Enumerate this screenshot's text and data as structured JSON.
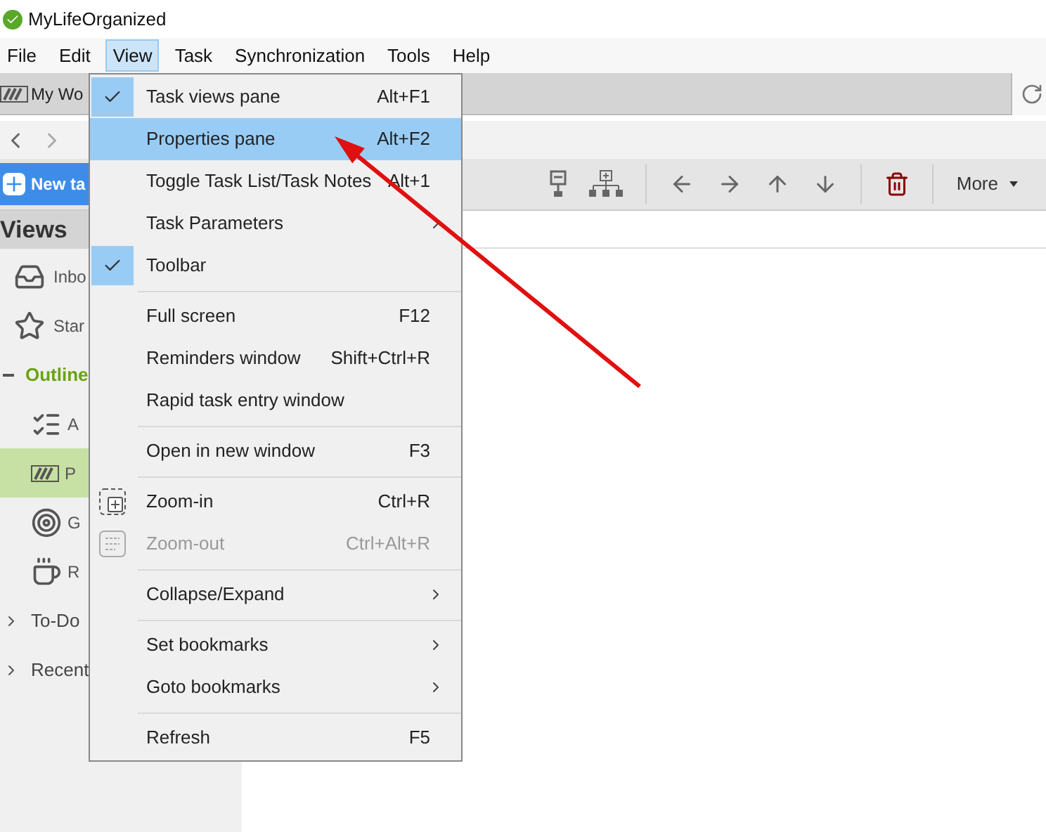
{
  "window": {
    "title": "MyLifeOrganized"
  },
  "menu_bar": [
    {
      "label": "File",
      "selected": false
    },
    {
      "label": "Edit",
      "selected": false
    },
    {
      "label": "View",
      "selected": true
    },
    {
      "label": "Task",
      "selected": false
    },
    {
      "label": "Synchronization",
      "selected": false
    },
    {
      "label": "Tools",
      "selected": false
    },
    {
      "label": "Help",
      "selected": false
    }
  ],
  "tab": {
    "label": "My Wo"
  },
  "toolbar": {
    "new_task": "New ta",
    "more": "More"
  },
  "sidebar": {
    "title": "Views",
    "items": [
      {
        "label": "Inbo",
        "kind": "inbox",
        "selected": false
      },
      {
        "label": "Star",
        "kind": "star",
        "selected": false
      },
      {
        "label": "Outline",
        "kind": "group",
        "expanded": true,
        "children": [
          {
            "label": "A",
            "kind": "checklist",
            "selected": false
          },
          {
            "label": "P",
            "kind": "project",
            "selected": true
          },
          {
            "label": "G",
            "kind": "target",
            "selected": false
          },
          {
            "label": "R",
            "kind": "cup",
            "selected": false
          }
        ]
      },
      {
        "label": "To-Do",
        "kind": "group",
        "expanded": false
      },
      {
        "label": "Recent",
        "kind": "group",
        "expanded": false
      }
    ]
  },
  "view_menu": [
    {
      "kind": "item",
      "label": "Task views pane",
      "shortcut": "Alt+F1",
      "checked": true,
      "selected": false,
      "disabled": false,
      "submenu": false
    },
    {
      "kind": "item",
      "label": "Properties pane",
      "shortcut": "Alt+F2",
      "checked": false,
      "selected": true,
      "disabled": false,
      "submenu": false
    },
    {
      "kind": "item",
      "label": "Toggle Task List/Task Notes",
      "shortcut": "Alt+1",
      "checked": false,
      "selected": false,
      "disabled": false,
      "submenu": false
    },
    {
      "kind": "item",
      "label": "Task Parameters",
      "checked": false,
      "selected": false,
      "disabled": false,
      "submenu": true
    },
    {
      "kind": "item",
      "label": "Toolbar",
      "checked": true,
      "selected": false,
      "disabled": false,
      "submenu": false
    },
    {
      "kind": "separator"
    },
    {
      "kind": "item",
      "label": "Full screen",
      "shortcut": "F12",
      "checked": false,
      "selected": false,
      "disabled": false,
      "submenu": false
    },
    {
      "kind": "item",
      "label": "Reminders window",
      "shortcut": "Shift+Ctrl+R",
      "checked": false,
      "selected": false,
      "disabled": false,
      "submenu": false
    },
    {
      "kind": "item",
      "label": "Rapid task entry window",
      "checked": false,
      "selected": false,
      "disabled": false,
      "submenu": false
    },
    {
      "kind": "separator"
    },
    {
      "kind": "item",
      "label": "Open in new window",
      "shortcut": "F3",
      "checked": false,
      "selected": false,
      "disabled": false,
      "submenu": false
    },
    {
      "kind": "separator"
    },
    {
      "kind": "zoom_in",
      "label": "Zoom-in",
      "shortcut": "Ctrl+R",
      "checked": false,
      "selected": false,
      "disabled": false,
      "submenu": false
    },
    {
      "kind": "zoom_out",
      "label": "Zoom-out",
      "shortcut": "Ctrl+Alt+R",
      "checked": false,
      "selected": false,
      "disabled": true,
      "submenu": false
    },
    {
      "kind": "separator"
    },
    {
      "kind": "item",
      "label": "Collapse/Expand",
      "checked": false,
      "selected": false,
      "disabled": false,
      "submenu": true
    },
    {
      "kind": "separator"
    },
    {
      "kind": "item",
      "label": "Set bookmarks",
      "checked": false,
      "selected": false,
      "disabled": false,
      "submenu": true
    },
    {
      "kind": "item",
      "label": "Goto bookmarks",
      "checked": false,
      "selected": false,
      "disabled": false,
      "submenu": true
    },
    {
      "kind": "separator"
    },
    {
      "kind": "item",
      "label": "Refresh",
      "shortcut": "F5",
      "checked": false,
      "selected": false,
      "disabled": false,
      "submenu": false
    }
  ]
}
